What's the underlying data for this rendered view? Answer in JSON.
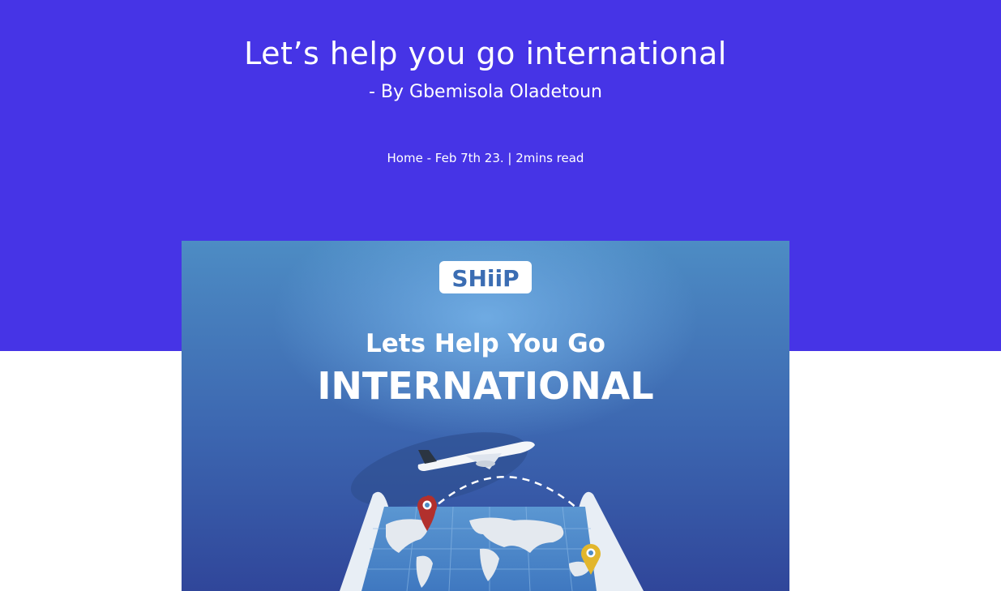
{
  "hero": {
    "title": "Let’s help you go international",
    "author": "- By Gbemisola Oladetoun",
    "breadcrumb_home": "Home",
    "meta": " - Feb 7th 23. | 2mins read",
    "background": "#4634e6"
  },
  "banner": {
    "logo": "SHiiP",
    "headline": "Lets Help You Go",
    "headline_big": "INTERNATIONAL",
    "icons": [
      "airplane-icon",
      "map-pin-red-icon",
      "map-pin-yellow-icon",
      "world-map-icon"
    ]
  }
}
